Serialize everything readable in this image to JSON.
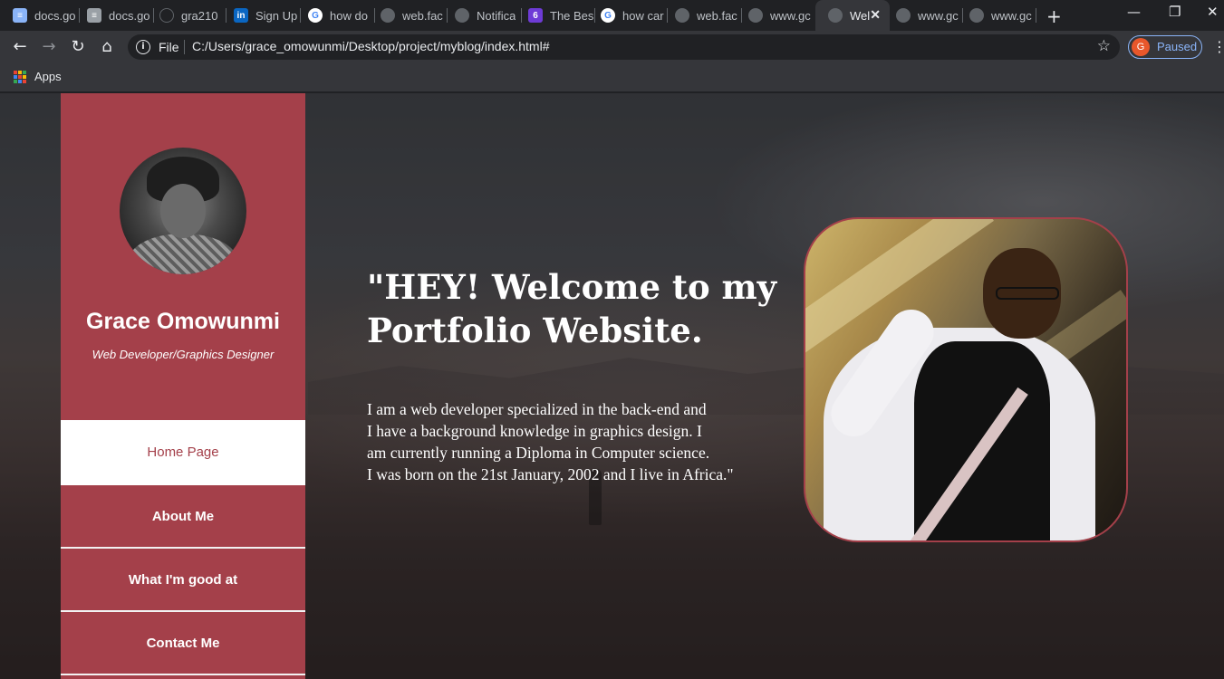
{
  "browser": {
    "tabs": [
      {
        "label": "docs.go",
        "icon": "docs-icon"
      },
      {
        "label": "docs.go",
        "icon": "docs-icon"
      },
      {
        "label": "gra210",
        "icon": "github-icon"
      },
      {
        "label": "Sign Up",
        "icon": "linkedin-icon"
      },
      {
        "label": "how do",
        "icon": "google-icon"
      },
      {
        "label": "web.fac",
        "icon": "globe-icon"
      },
      {
        "label": "Notifica",
        "icon": "globe-icon"
      },
      {
        "label": "The Bes",
        "icon": "six-icon"
      },
      {
        "label": "how car",
        "icon": "google-icon"
      },
      {
        "label": "web.fac",
        "icon": "globe-icon"
      },
      {
        "label": "www.gc",
        "icon": "globe-icon"
      },
      {
        "label": "Wel",
        "icon": "globe-icon",
        "active": true
      },
      {
        "label": "www.gc",
        "icon": "globe-icon"
      },
      {
        "label": "www.gc",
        "icon": "globe-icon"
      }
    ],
    "scheme": "File",
    "url": "C:/Users/grace_omowunmi/Desktop/project/myblog/index.html#",
    "profile_initial": "G",
    "profile_status": "Paused",
    "bookmarks_apps": "Apps"
  },
  "sidebar": {
    "name": "Grace Omowunmi",
    "role": "Web Developer/Graphics Designer",
    "nav": [
      {
        "label": "Home Page",
        "active": true
      },
      {
        "label": "About Me"
      },
      {
        "label": "What I'm good at"
      },
      {
        "label": "Contact Me"
      }
    ]
  },
  "hero": {
    "title_line1": "\"HEY! Welcome to my",
    "title_line2": "Portfolio Website.",
    "text_lines": [
      "I am a web developer specialized in the back-end and",
      "I have a background knowledge in graphics design. I",
      "am currently running a Diploma in Computer science.",
      "I was born on the 21st January, 2002 and I live in Africa.\""
    ]
  },
  "colors": {
    "accent": "#a4404a",
    "chrome_dark": "#202124",
    "chrome_toolbar": "#35363a",
    "link_blue": "#8ab4f8"
  }
}
